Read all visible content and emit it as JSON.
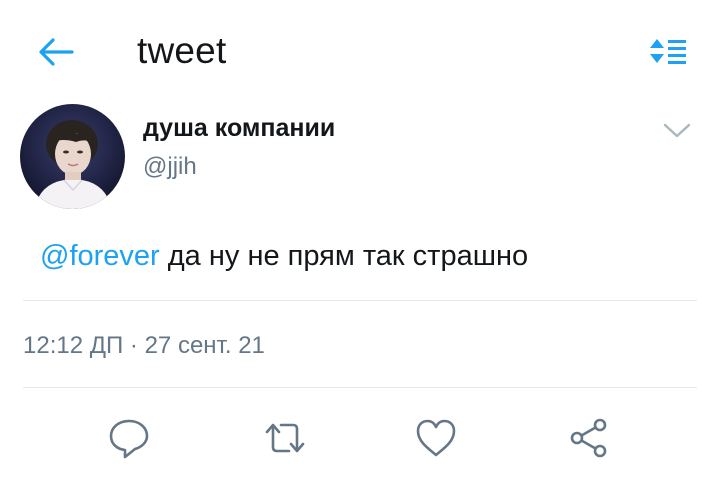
{
  "header": {
    "title": "tweet",
    "back_icon": "arrow-left-icon",
    "sort_icon": "sort-list-icon",
    "accent": "#1da1f2"
  },
  "tweet": {
    "author": {
      "display_name": "душа компании",
      "handle": "@jjih",
      "avatar_icon": "avatar-photo"
    },
    "mention": "@forever",
    "text": " да ну не прям так страшно",
    "time": "12:12 ДП",
    "separator": "·",
    "date": "27 сент. 21"
  },
  "actions": [
    {
      "name": "reply",
      "icon": "speech-bubble-icon"
    },
    {
      "name": "retweet",
      "icon": "retweet-icon"
    },
    {
      "name": "like",
      "icon": "heart-icon"
    },
    {
      "name": "share",
      "icon": "share-icon"
    }
  ],
  "colors": {
    "text": "#14171a",
    "secondary": "#657786",
    "link": "#1da1f2",
    "divider": "#e1e8ed"
  }
}
